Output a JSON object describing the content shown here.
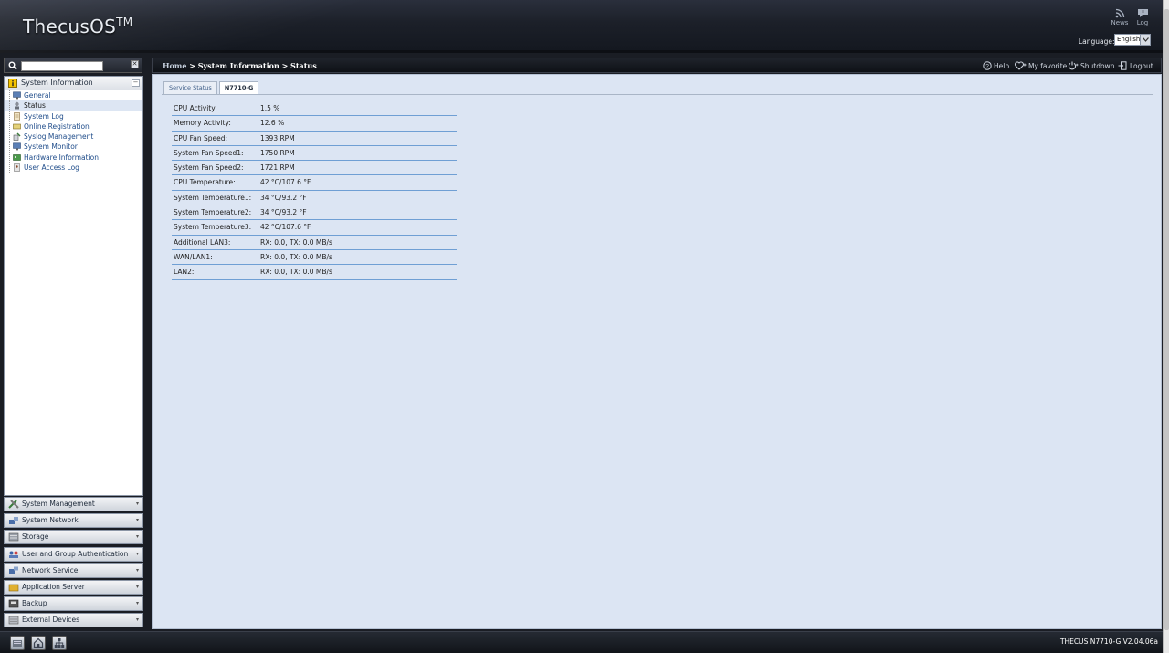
{
  "header": {
    "logo": "ThecusOS",
    "logo_tm": "TM",
    "news_label": "News",
    "log_label": "Log",
    "language_label": "Language:",
    "language_value": "English"
  },
  "sidebar": {
    "tree_title": "System Information",
    "tree_items": [
      {
        "label": "General",
        "icon": "monitor-icon"
      },
      {
        "label": "Status",
        "icon": "status-icon"
      },
      {
        "label": "System Log",
        "icon": "log-icon"
      },
      {
        "label": "Online Registration",
        "icon": "registration-icon"
      },
      {
        "label": "Syslog Management",
        "icon": "syslog-icon"
      },
      {
        "label": "System Monitor",
        "icon": "monitor-icon"
      },
      {
        "label": "Hardware Information",
        "icon": "hardware-icon"
      },
      {
        "label": "User Access Log",
        "icon": "user-log-icon"
      }
    ],
    "sections": [
      {
        "label": "System Management",
        "icon": "tools-icon"
      },
      {
        "label": "System Network",
        "icon": "network-icon"
      },
      {
        "label": "Storage",
        "icon": "storage-icon"
      },
      {
        "label": "User and Group Authentication",
        "icon": "users-icon"
      },
      {
        "label": "Network Service",
        "icon": "network-service-icon"
      },
      {
        "label": "Application Server",
        "icon": "app-server-icon"
      },
      {
        "label": "Backup",
        "icon": "backup-icon"
      },
      {
        "label": "External Devices",
        "icon": "external-devices-icon"
      }
    ]
  },
  "main": {
    "breadcrumb_home": "Home",
    "breadcrumb_rest": " > System Information > Status",
    "actions": {
      "help": "Help",
      "favorite": "My favorite",
      "shutdown": "Shutdown",
      "logout": "Logout"
    },
    "tabs": [
      "Service Status",
      "N7710-G"
    ],
    "status_rows": [
      {
        "key": "CPU Activity:",
        "value": "1.5 %"
      },
      {
        "key": "Memory Activity:",
        "value": "12.6 %"
      },
      {
        "key": "CPU Fan Speed:",
        "value": "1393 RPM"
      },
      {
        "key": "System Fan Speed1:",
        "value": "1750 RPM"
      },
      {
        "key": "System Fan Speed2:",
        "value": "1721 RPM"
      },
      {
        "key": "CPU Temperature:",
        "value": "42 °C/107.6 °F"
      },
      {
        "key": "System Temperature1:",
        "value": "34 °C/93.2 °F"
      },
      {
        "key": "System Temperature2:",
        "value": "34 °C/93.2 °F"
      },
      {
        "key": "System Temperature3:",
        "value": "42 °C/107.6 °F"
      },
      {
        "key": "Additional LAN3:",
        "value": "RX: 0.0, TX: 0.0 MB/s"
      },
      {
        "key": "WAN/LAN1:",
        "value": "RX: 0.0, TX: 0.0 MB/s"
      },
      {
        "key": "LAN2:",
        "value": "RX: 0.0, TX: 0.0 MB/s"
      }
    ]
  },
  "footer": {
    "version": "THECUS N7710-G V2.04.06a"
  }
}
